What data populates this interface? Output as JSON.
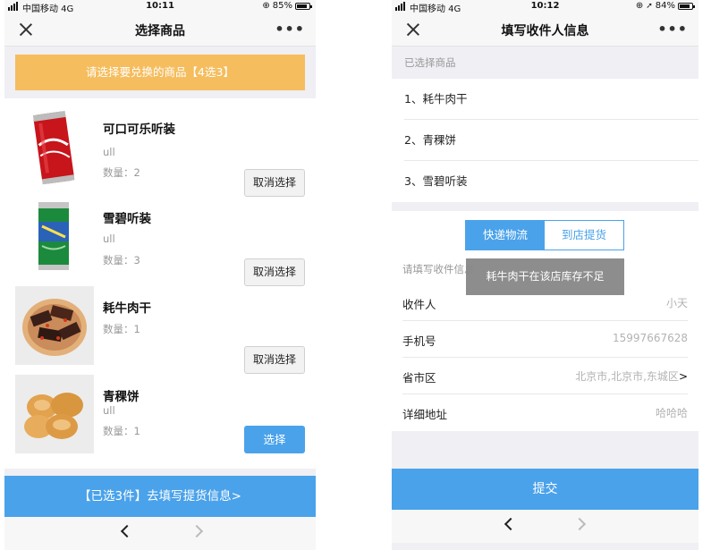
{
  "left": {
    "status": {
      "carrier": "中国移动 4G",
      "time": "10:11",
      "battery": "85%",
      "battery_level": 0.85,
      "orientation_icon": "rotation-lock-icon"
    },
    "nav": {
      "title": "选择商品",
      "close_icon": "close-icon",
      "more": "•••"
    },
    "banner": "请选择要兑换的商品【4选3】",
    "items": [
      {
        "name": "可口可乐听装",
        "sub": "ull",
        "qty": "数量：2",
        "action": "取消选择",
        "selected": true,
        "image": "coca-cola-can-image"
      },
      {
        "name": "雪碧听装",
        "sub": "ull",
        "qty": "数量：3",
        "action": "取消选择",
        "selected": true,
        "image": "sprite-can-image"
      },
      {
        "name": "耗牛肉干",
        "sub": "",
        "qty": "数量：1",
        "action": "取消选择",
        "selected": true,
        "image": "beef-jerky-image"
      },
      {
        "name": "青稞饼",
        "sub": "ull",
        "qty": "数量：1",
        "action": "选择",
        "selected": false,
        "image": "barley-cake-image"
      }
    ],
    "bottom_button": "【已选3件】去填写提货信息>",
    "bottom_nav": {
      "back_icon": "chevron-left-icon",
      "forward_icon": "chevron-right-icon"
    }
  },
  "right": {
    "status": {
      "carrier": "中国移动 4G",
      "time": "10:12",
      "battery": "84%",
      "battery_level": 0.84,
      "location_icon": "location-arrow-icon"
    },
    "nav": {
      "title": "填写收件人信息",
      "close_icon": "close-icon",
      "more": "•••"
    },
    "selected_label": "已选择商品",
    "selected_goods": [
      "1、耗牛肉干",
      "2、青稞饼",
      "3、雪碧听装"
    ],
    "delivery_tabs": {
      "active": "快递物流",
      "inactive": "到店提货"
    },
    "form_hint": "请填写收件信息",
    "toast": "耗牛肉干在该店库存不足",
    "fields": [
      {
        "label": "收件人",
        "value": "小天",
        "arrow": ""
      },
      {
        "label": "手机号",
        "value": "15997667628",
        "arrow": ""
      },
      {
        "label": "省市区",
        "value": "北京市,北京市,东城区",
        "arrow": ">"
      },
      {
        "label": "详细地址",
        "value": "哈哈哈",
        "arrow": ""
      }
    ],
    "submit": "提交",
    "bottom_nav": {
      "back_icon": "chevron-left-icon",
      "forward_icon": "chevron-right-icon"
    }
  }
}
